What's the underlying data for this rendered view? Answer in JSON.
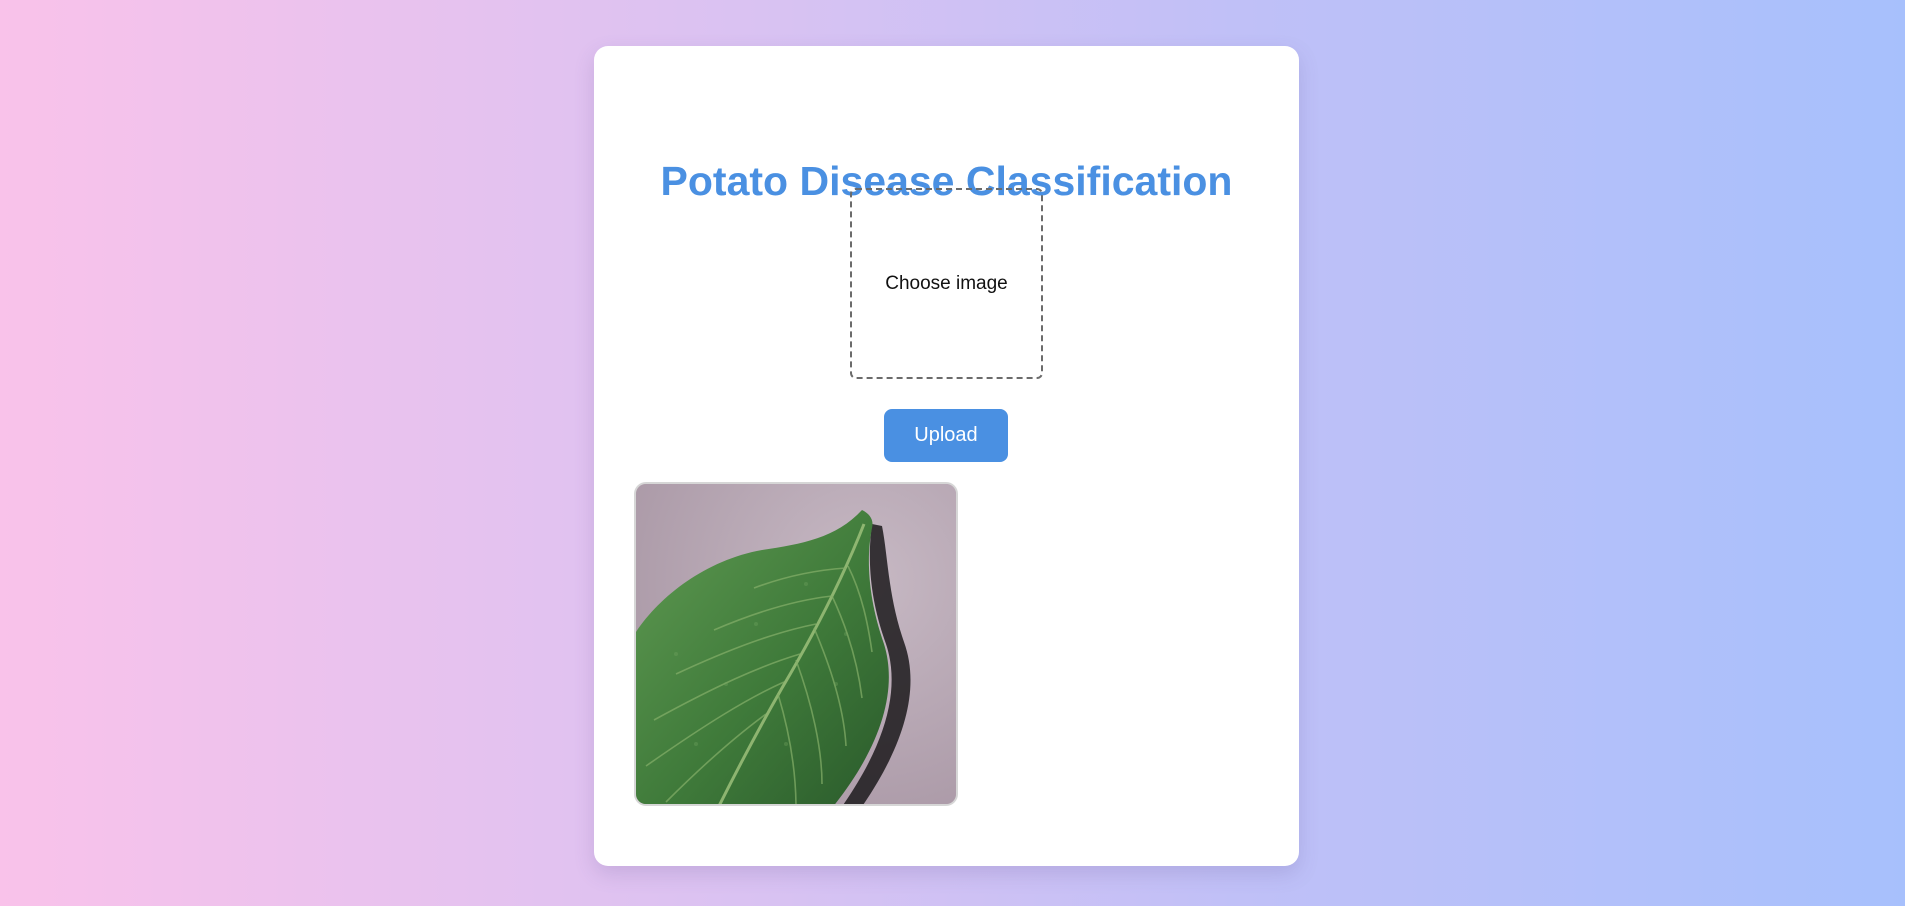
{
  "page": {
    "title": "Potato Disease Classification"
  },
  "uploader": {
    "choose_label": "Choose image",
    "upload_label": "Upload"
  },
  "preview": {
    "subject": "potato leaf"
  },
  "colors": {
    "accent": "#4a90e2",
    "card_bg": "#ffffff",
    "background_left": "#f9c2ea",
    "background_right": "#a7c0fc"
  }
}
